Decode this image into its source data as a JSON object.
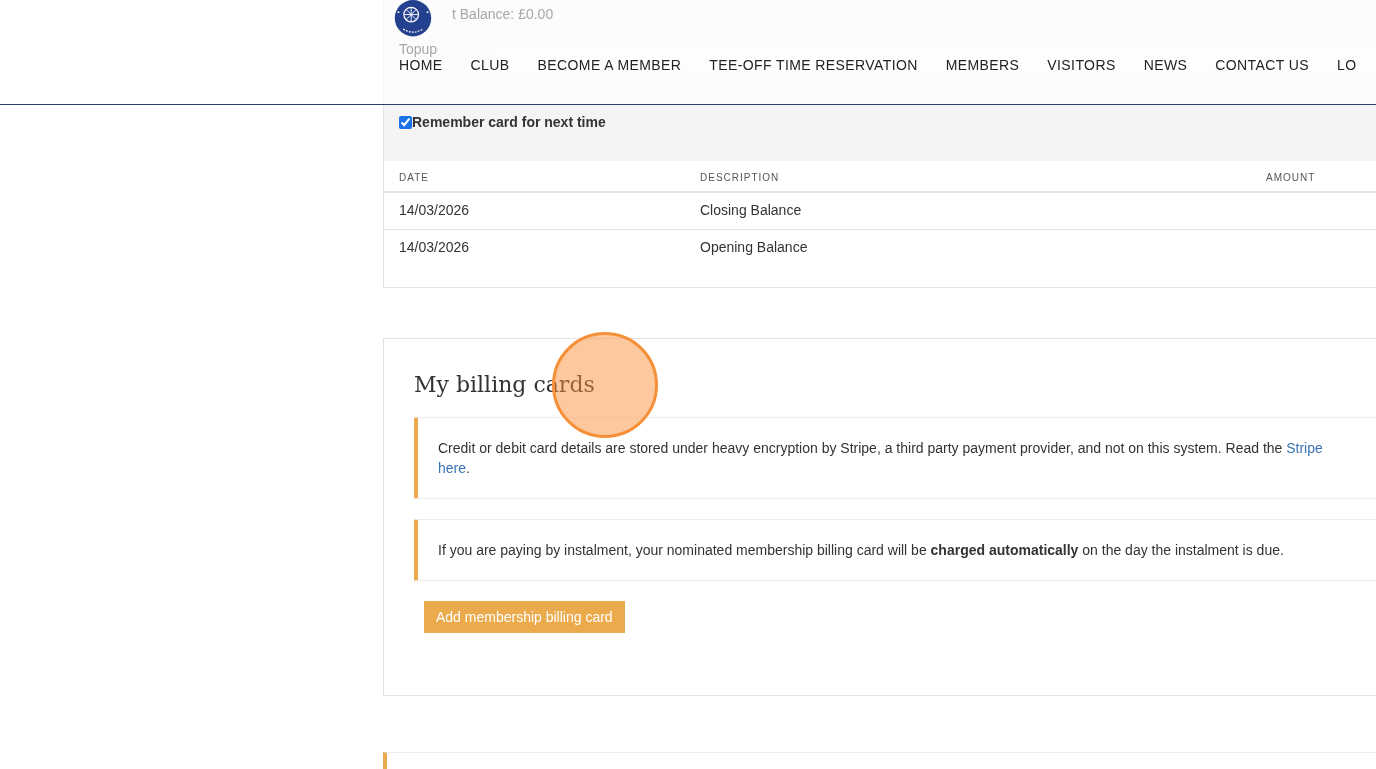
{
  "header": {
    "nav": [
      {
        "label": "HOME"
      },
      {
        "label": "CLUB"
      },
      {
        "label": "BECOME A MEMBER"
      },
      {
        "label": "TEE-OFF TIME RESERVATION"
      },
      {
        "label": "MEMBERS"
      },
      {
        "label": "VISITORS"
      },
      {
        "label": "NEWS"
      },
      {
        "label": "CONTACT US"
      },
      {
        "label": "LO"
      }
    ]
  },
  "topup_form": {
    "balance": "t Balance: £0.00",
    "topup_label": "Topup",
    "remember_card": {
      "label": "Remember card for next time",
      "checked": true
    }
  },
  "transactions": {
    "columns": [
      "DATE",
      "DESCRIPTION",
      "AMOUNT"
    ],
    "rows": [
      {
        "date": "14/03/2026",
        "description": "Closing Balance"
      },
      {
        "date": "14/03/2026",
        "description": "Opening Balance"
      }
    ]
  },
  "billing_cards": {
    "title": "My billing cards",
    "notices": [
      {
        "kind": "links",
        "text": "Credit or debit card details are stored under heavy encryption by Stripe, a third party payment provider, and not on this system. Read the",
        "link": "Stripe",
        "link2": "here",
        "suffix": "."
      },
      {
        "kind": "plain",
        "text": "If you are paying by instalment, your nominated membership billing card will be **charged automatically** on the day the instalment is due."
      }
    ],
    "button": "Add membership billing card"
  }
}
